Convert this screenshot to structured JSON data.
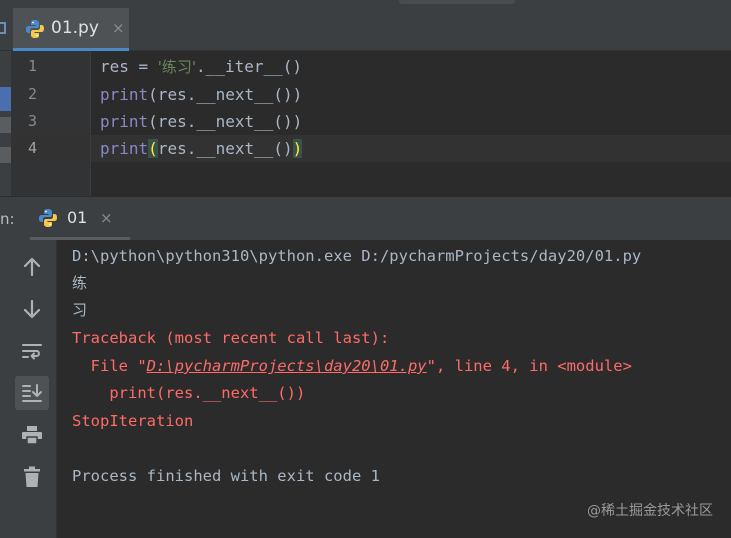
{
  "editor": {
    "tab": {
      "label": "01.py",
      "close": "×"
    },
    "lines": [
      {
        "no": "1",
        "code": ""
      },
      {
        "no": "2",
        "code": ""
      },
      {
        "no": "3",
        "code": ""
      },
      {
        "no": "4",
        "code": ""
      }
    ],
    "tokens": {
      "res_assign": "res = ",
      "cn_string": "'练习'",
      "iter_call": ".__iter__()",
      "print": "print",
      "next_args": "(res.__next__())",
      "open_paren": "(",
      "next_mid": "res.__next__()",
      "close_paren": ")"
    },
    "caret_line": 4
  },
  "run": {
    "label_fragment": "n:",
    "tab": {
      "label": "01",
      "close": "×"
    },
    "toolbar": [
      "up-arrow-icon",
      "down-arrow-icon",
      "soft-wrap-icon",
      "scroll-to-end-icon",
      "print-icon",
      "trash-icon"
    ],
    "output": {
      "command": "D:\\python\\python310\\python.exe D:/pycharmProjects/day20/01.py",
      "out1": "练",
      "out2": "习",
      "traceback_head": "Traceback (most recent call last):",
      "file_prefix": "  File \"",
      "file_link": "D:\\pycharmProjects\\day20\\01.py",
      "file_suffix": "\", line 4, in <module>",
      "code_line": "    print(res.__next__())",
      "error": "StopIteration",
      "exit": "Process finished with exit code 1"
    }
  },
  "watermark": "@稀土掘金技术社区",
  "colors": {
    "background": "#2b2b2b",
    "panel": "#3c3f41",
    "tab_active": "#4e5254",
    "tab_underline": "#4a88c7",
    "keyword": "#8888c6",
    "string": "#6a8759",
    "error": "#ff6b68",
    "text": "#a9b7c6"
  }
}
